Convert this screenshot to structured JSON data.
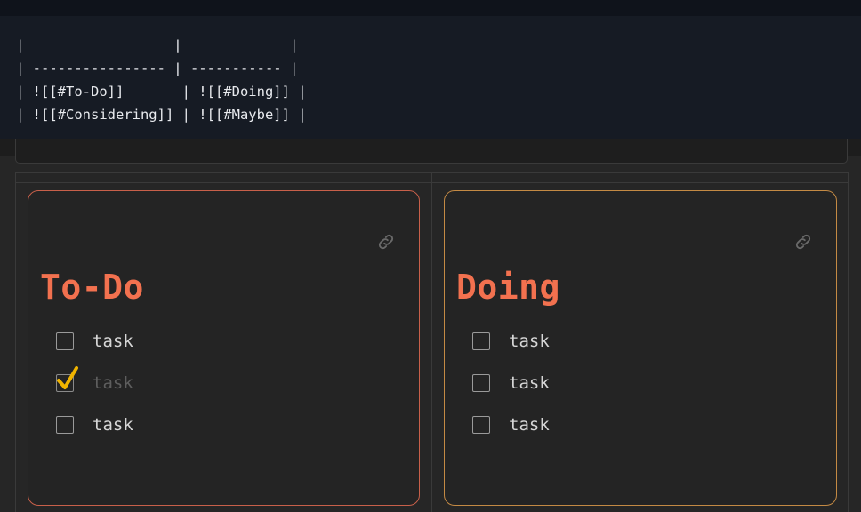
{
  "code_block": {
    "lines": [
      "|                  |             |",
      "| ---------------- | ----------- |",
      "| ![[#To-Do]]       | ![[#Doing]] |",
      "| ![[#Considering]] | ![[#Maybe]] |"
    ]
  },
  "cards": [
    {
      "title": "To-Do",
      "border_color": "#c8604a",
      "tasks": [
        {
          "label": "task",
          "checked": false
        },
        {
          "label": "task",
          "checked": true
        },
        {
          "label": "task",
          "checked": false
        }
      ]
    },
    {
      "title": "Doing",
      "border_color": "#c48a44",
      "tasks": [
        {
          "label": "task",
          "checked": false
        },
        {
          "label": "task",
          "checked": false
        },
        {
          "label": "task",
          "checked": false
        }
      ]
    }
  ],
  "icons": {
    "link": "link-icon",
    "check": "check-icon"
  },
  "colors": {
    "title": "#f2714f",
    "check": "#f0b400",
    "code_bg": "#161b24"
  }
}
